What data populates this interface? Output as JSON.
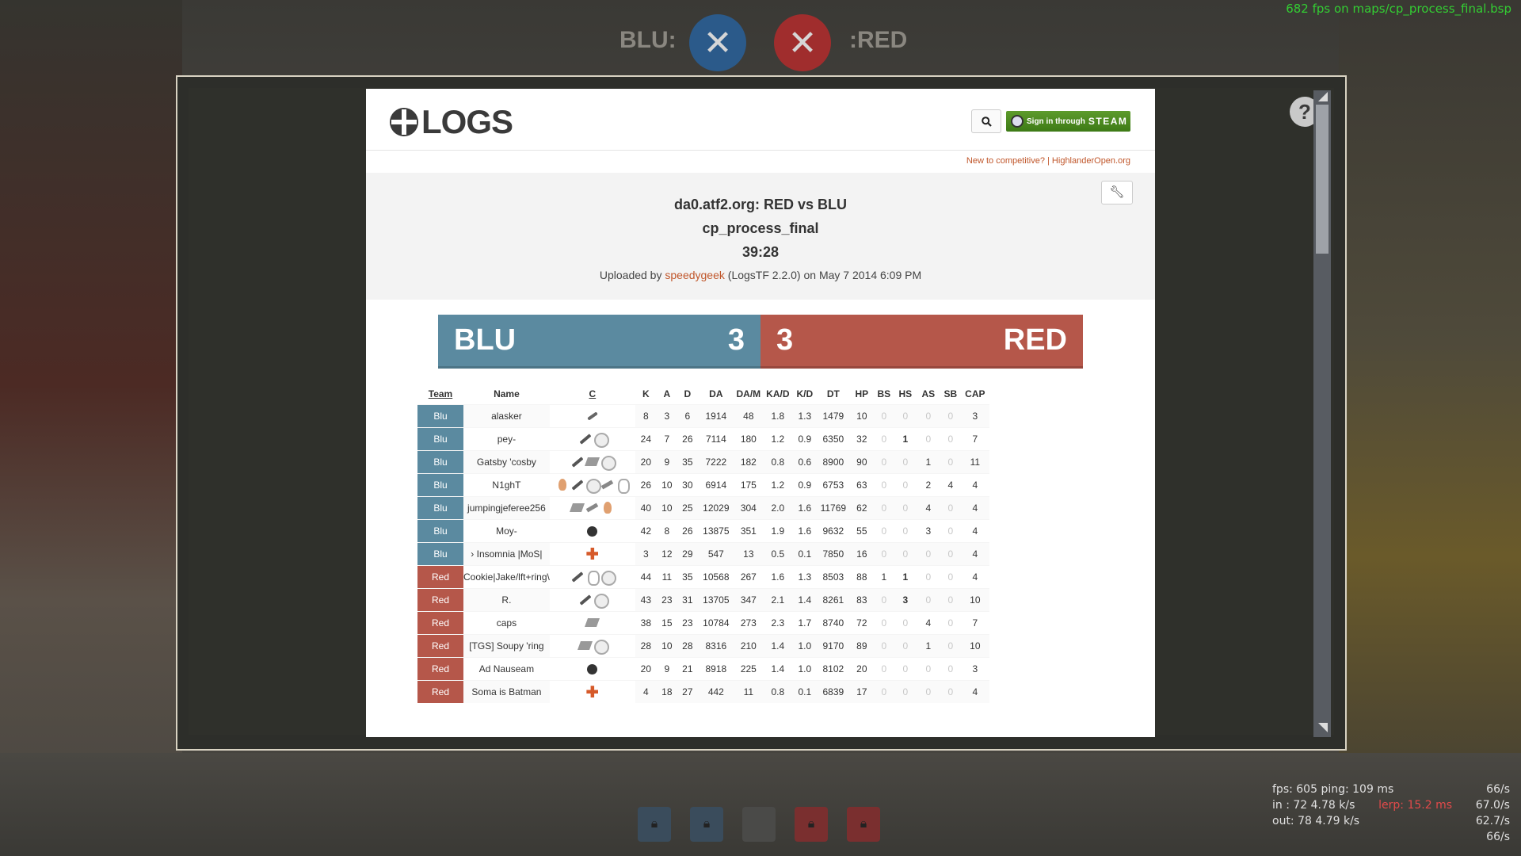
{
  "hud": {
    "blu_label": "BLU:",
    "red_label": ":RED",
    "fps_top": "682 fps on maps/cp_process_final.bsp"
  },
  "site": {
    "logo_text": "LOGS",
    "steam_label": "Sign in through",
    "steam_word": "STEAM",
    "promo": "New to competitive? | HighlanderOpen.org"
  },
  "match": {
    "title": "da0.atf2.org: RED vs BLU",
    "map": "cp_process_final",
    "duration": "39:28",
    "uploaded_prefix": "Uploaded by",
    "uploader": "speedygeek",
    "uploaded_suffix": "(LogsTF 2.2.0) on May 7 2014 6:09 PM"
  },
  "score": {
    "blu_name": "BLU",
    "blu_score": "3",
    "red_name": "RED",
    "red_score": "3"
  },
  "table": {
    "headers": [
      "Team",
      "Name",
      "C",
      "K",
      "A",
      "D",
      "DA",
      "DA/M",
      "KA/D",
      "K/D",
      "DT",
      "HP",
      "BS",
      "HS",
      "AS",
      "SB",
      "CAP"
    ],
    "rows": [
      {
        "team": "Blu",
        "name": "alasker",
        "classes": [
          "scout"
        ],
        "stats": [
          "8",
          "3",
          "6",
          "1914",
          "48",
          "1.8",
          "1.3",
          "1479",
          "10",
          "0",
          "0",
          "0",
          "0",
          "3"
        ]
      },
      {
        "team": "Blu",
        "name": "pey-",
        "classes": [
          "soldier",
          "medic"
        ],
        "stats": [
          "24",
          "7",
          "26",
          "7114",
          "180",
          "1.2",
          "0.9",
          "6350",
          "32",
          "0",
          "1",
          "0",
          "0",
          "7"
        ]
      },
      {
        "team": "Blu",
        "name": "Gatsby 'cosby",
        "classes": [
          "soldier",
          "sniper",
          "medic"
        ],
        "stats": [
          "20",
          "9",
          "35",
          "7222",
          "182",
          "0.8",
          "0.6",
          "8900",
          "90",
          "0",
          "0",
          "1",
          "0",
          "11"
        ]
      },
      {
        "team": "Blu",
        "name": "N1ghT",
        "classes": [
          "pyro",
          "soldier",
          "medic",
          "engineer",
          "spy"
        ],
        "stats": [
          "26",
          "10",
          "30",
          "6914",
          "175",
          "1.2",
          "0.9",
          "6753",
          "63",
          "0",
          "0",
          "2",
          "4",
          "4"
        ]
      },
      {
        "team": "Blu",
        "name": "jumpingjeferee256",
        "classes": [
          "sniper",
          "engineer",
          "pyro"
        ],
        "stats": [
          "40",
          "10",
          "25",
          "12029",
          "304",
          "2.0",
          "1.6",
          "11769",
          "62",
          "0",
          "0",
          "4",
          "0",
          "4"
        ]
      },
      {
        "team": "Blu",
        "name": "Moy-",
        "classes": [
          "demoman"
        ],
        "stats": [
          "42",
          "8",
          "26",
          "13875",
          "351",
          "1.9",
          "1.6",
          "9632",
          "55",
          "0",
          "0",
          "3",
          "0",
          "4"
        ]
      },
      {
        "team": "Blu",
        "name": "› Insomnia |MoS|",
        "classes": [
          "heavy"
        ],
        "stats": [
          "3",
          "12",
          "29",
          "547",
          "13",
          "0.5",
          "0.1",
          "7850",
          "16",
          "0",
          "0",
          "0",
          "0",
          "4"
        ]
      },
      {
        "team": "Red",
        "name": "Cookie|Jake/lft+ring\\",
        "classes": [
          "soldier",
          "spy",
          "medic"
        ],
        "stats": [
          "44",
          "11",
          "35",
          "10568",
          "267",
          "1.6",
          "1.3",
          "8503",
          "88",
          "1",
          "1",
          "0",
          "0",
          "4"
        ]
      },
      {
        "team": "Red",
        "name": "R.",
        "classes": [
          "soldier",
          "medic"
        ],
        "stats": [
          "43",
          "23",
          "31",
          "13705",
          "347",
          "2.1",
          "1.4",
          "8261",
          "83",
          "0",
          "3",
          "0",
          "0",
          "10"
        ]
      },
      {
        "team": "Red",
        "name": "caps",
        "classes": [
          "sniper"
        ],
        "stats": [
          "38",
          "15",
          "23",
          "10784",
          "273",
          "2.3",
          "1.7",
          "8740",
          "72",
          "0",
          "0",
          "4",
          "0",
          "7"
        ]
      },
      {
        "team": "Red",
        "name": "[TGS] Soupy 'ring",
        "classes": [
          "sniper",
          "medic"
        ],
        "stats": [
          "28",
          "10",
          "28",
          "8316",
          "210",
          "1.4",
          "1.0",
          "9170",
          "89",
          "0",
          "0",
          "1",
          "0",
          "10"
        ]
      },
      {
        "team": "Red",
        "name": "Ad Nauseam",
        "classes": [
          "demoman"
        ],
        "stats": [
          "20",
          "9",
          "21",
          "8918",
          "225",
          "1.4",
          "1.0",
          "8102",
          "20",
          "0",
          "0",
          "0",
          "0",
          "3"
        ]
      },
      {
        "team": "Red",
        "name": "Soma is Batman",
        "classes": [
          "heavy"
        ],
        "stats": [
          "4",
          "18",
          "27",
          "442",
          "11",
          "0.8",
          "0.1",
          "6839",
          "17",
          "0",
          "0",
          "0",
          "0",
          "4"
        ]
      }
    ]
  },
  "net": {
    "fps": "fps:  605   ping:  109 ms",
    "fps_right": "66/s",
    "in_left": "in :  72    4.78 k/s",
    "lerp": "lerp:   15.2 ms",
    "in_right": "67.0/s",
    "out_left": "out:  78    4.79 k/s",
    "out_right": "62.7/s",
    "last_right": "66/s"
  },
  "colors": {
    "blu": "#5b8aa0",
    "red": "#b5574a",
    "accent": "#c0562a",
    "steam": "#4f8b22"
  }
}
